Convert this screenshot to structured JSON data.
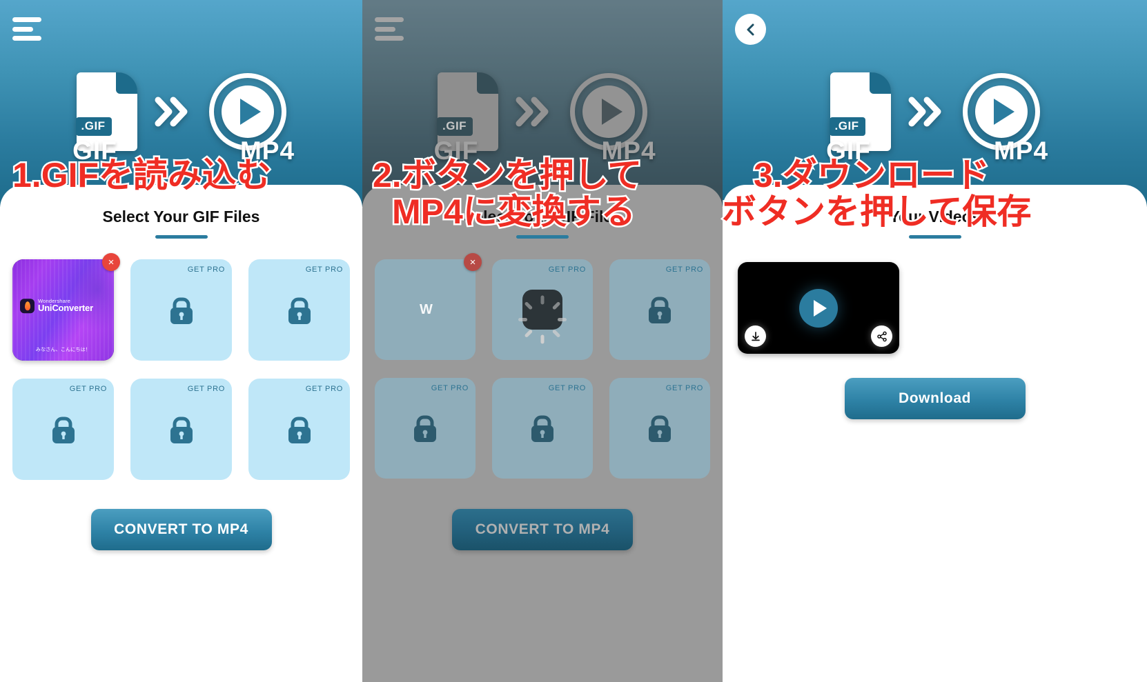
{
  "app": {
    "hero": {
      "gif_label": "GIF",
      "mp4_label": "MP4",
      "gif_file_tag": ".GIF",
      "chevron_icon": "double-chevron-right-icon"
    },
    "colors": {
      "accent": "#2b7c9f",
      "hero_top": "#55a6cb",
      "hero_bottom": "#1d6b8b",
      "tile": "#bfe7f8",
      "tile_dim": "#8fadba",
      "overlay_red": "#ef2d24",
      "close_badge": "#e8453c"
    }
  },
  "panels": [
    {
      "id": "step-1",
      "menu_icon": "hamburger-menu-icon",
      "sheet_title": "Select Your GIF Files",
      "tiles": [
        {
          "type": "thumbnail",
          "brand_small": "Wondershare",
          "brand_large": "UniConverter",
          "caption": "みなさん、こんにちは！",
          "close_label": "×"
        },
        {
          "type": "locked",
          "badge": "GET PRO",
          "icon": "lock-icon"
        },
        {
          "type": "locked",
          "badge": "GET PRO",
          "icon": "lock-icon"
        },
        {
          "type": "locked",
          "badge": "GET PRO",
          "icon": "lock-icon"
        },
        {
          "type": "locked",
          "badge": "GET PRO",
          "icon": "lock-icon"
        },
        {
          "type": "locked",
          "badge": "GET PRO",
          "icon": "lock-icon"
        }
      ],
      "cta_label": "CONVERT TO MP4",
      "overlay_text": "1.GIFを読み込む"
    },
    {
      "id": "step-2",
      "menu_icon": "hamburger-menu-icon",
      "sheet_title": "Select Your GIF Files",
      "tiles": [
        {
          "type": "dark",
          "mark": "W",
          "close_label": "×"
        },
        {
          "type": "loading",
          "badge": "GET PRO",
          "icon": "spinner-icon"
        },
        {
          "type": "locked",
          "badge": "GET PRO",
          "icon": "lock-icon"
        },
        {
          "type": "locked",
          "badge": "GET PRO",
          "icon": "lock-icon"
        },
        {
          "type": "locked",
          "badge": "GET PRO",
          "icon": "lock-icon"
        },
        {
          "type": "locked",
          "badge": "GET PRO",
          "icon": "lock-icon"
        }
      ],
      "cta_label": "CONVERT TO MP4",
      "overlay_text_line1": "2.ボタンを押して",
      "overlay_text_line2": "MP4に変換する"
    },
    {
      "id": "step-3",
      "back_icon": "chevron-left-icon",
      "sheet_title": "Your Videos",
      "video": {
        "play_icon": "play-icon",
        "download_icon": "download-arrow-icon",
        "share_icon": "share-icon"
      },
      "cta_label": "Download",
      "overlay_text_line1": "3.ダウンロード",
      "overlay_text_line2": "ボタンを押して保存"
    }
  ]
}
